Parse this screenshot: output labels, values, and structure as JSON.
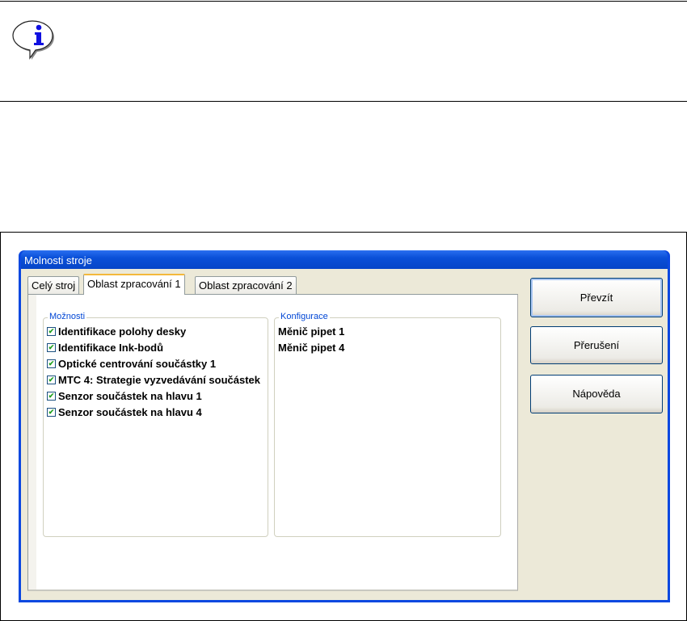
{
  "note": {
    "icon": "info-icon"
  },
  "dialog": {
    "title": "Molnosti stroje",
    "tabs": [
      "Celý stroj",
      "Oblast zpracování 1",
      "Oblast zpracování 2"
    ],
    "active_tab": 1,
    "options_group": {
      "label": "Možnosti",
      "items": [
        {
          "label": "Identifikace polohy desky",
          "checked": true
        },
        {
          "label": "Identifikace Ink-bodů",
          "checked": true
        },
        {
          "label": "Optické centrování součástky 1",
          "checked": true
        },
        {
          "label": "MTC 4: Strategie vyzvedávání součástek",
          "checked": true
        },
        {
          "label": "Senzor součástek na hlavu 1",
          "checked": true
        },
        {
          "label": "Senzor součástek na hlavu 4",
          "checked": true
        }
      ]
    },
    "config_group": {
      "label": "Konfigurace",
      "items": [
        "Měnič pipet 1",
        "Měnič pipet 4"
      ]
    },
    "buttons": {
      "accept": "Převzít",
      "cancel": "Přerušení",
      "help": "Nápověda"
    },
    "colors": {
      "titlebar": "#0a50d8",
      "legend": "#0046d5",
      "face": "#ece9d8"
    }
  }
}
